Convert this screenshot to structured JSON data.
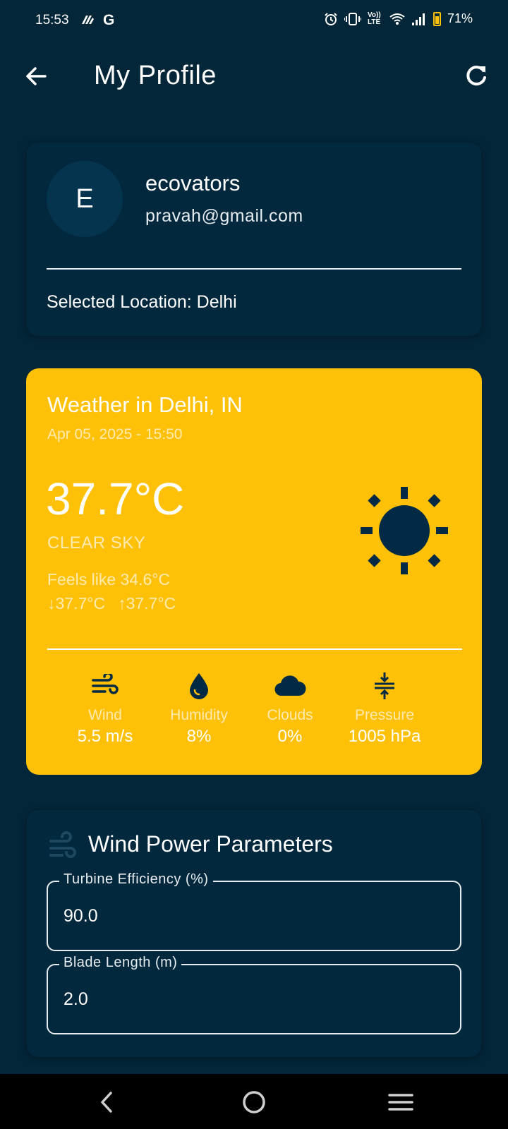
{
  "status_bar": {
    "time": "15:53",
    "left_icons": [
      "cloud-icon",
      "google-icon"
    ],
    "google_glyph": "G",
    "volte": "Vo)) LTE",
    "battery": "71%"
  },
  "app_bar": {
    "title": "My Profile",
    "back_icon": "arrow-back-icon",
    "refresh_icon": "refresh-icon"
  },
  "profile": {
    "avatar_letter": "E",
    "name": "ecovators",
    "email": "pravah@gmail.com",
    "selected_location": "Selected Location: Delhi"
  },
  "weather": {
    "title": "Weather in Delhi, IN",
    "datetime": "Apr 05, 2025 - 15:50",
    "temperature": "37.7°C",
    "condition": "CLEAR SKY",
    "feels_like": "Feels like 34.6°C",
    "min": "↓37.7°C",
    "max": "↑37.7°C",
    "accent_color": "#ffc107",
    "icon": "sun-icon",
    "metrics": [
      {
        "label": "Wind",
        "value": "5.5 m/s",
        "icon": "wind-icon"
      },
      {
        "label": "Humidity",
        "value": "8%",
        "icon": "water-drop-icon"
      },
      {
        "label": "Clouds",
        "value": "0%",
        "icon": "cloud-icon"
      },
      {
        "label": "Pressure",
        "value": "1005 hPa",
        "icon": "pressure-icon"
      }
    ]
  },
  "wind_power": {
    "title": "Wind Power Parameters",
    "icon": "wind-turbine-icon",
    "fields": [
      {
        "label": "Turbine Efficiency (%)",
        "value": "90.0"
      },
      {
        "label": "Blade Length (m)",
        "value": "2.0"
      }
    ]
  },
  "colors": {
    "background": "#032639",
    "card": "#02283d",
    "icon_dark": "#032a44"
  },
  "nav_bar": {
    "buttons": [
      "nav-back-icon",
      "nav-home-icon",
      "nav-menu-icon"
    ]
  }
}
